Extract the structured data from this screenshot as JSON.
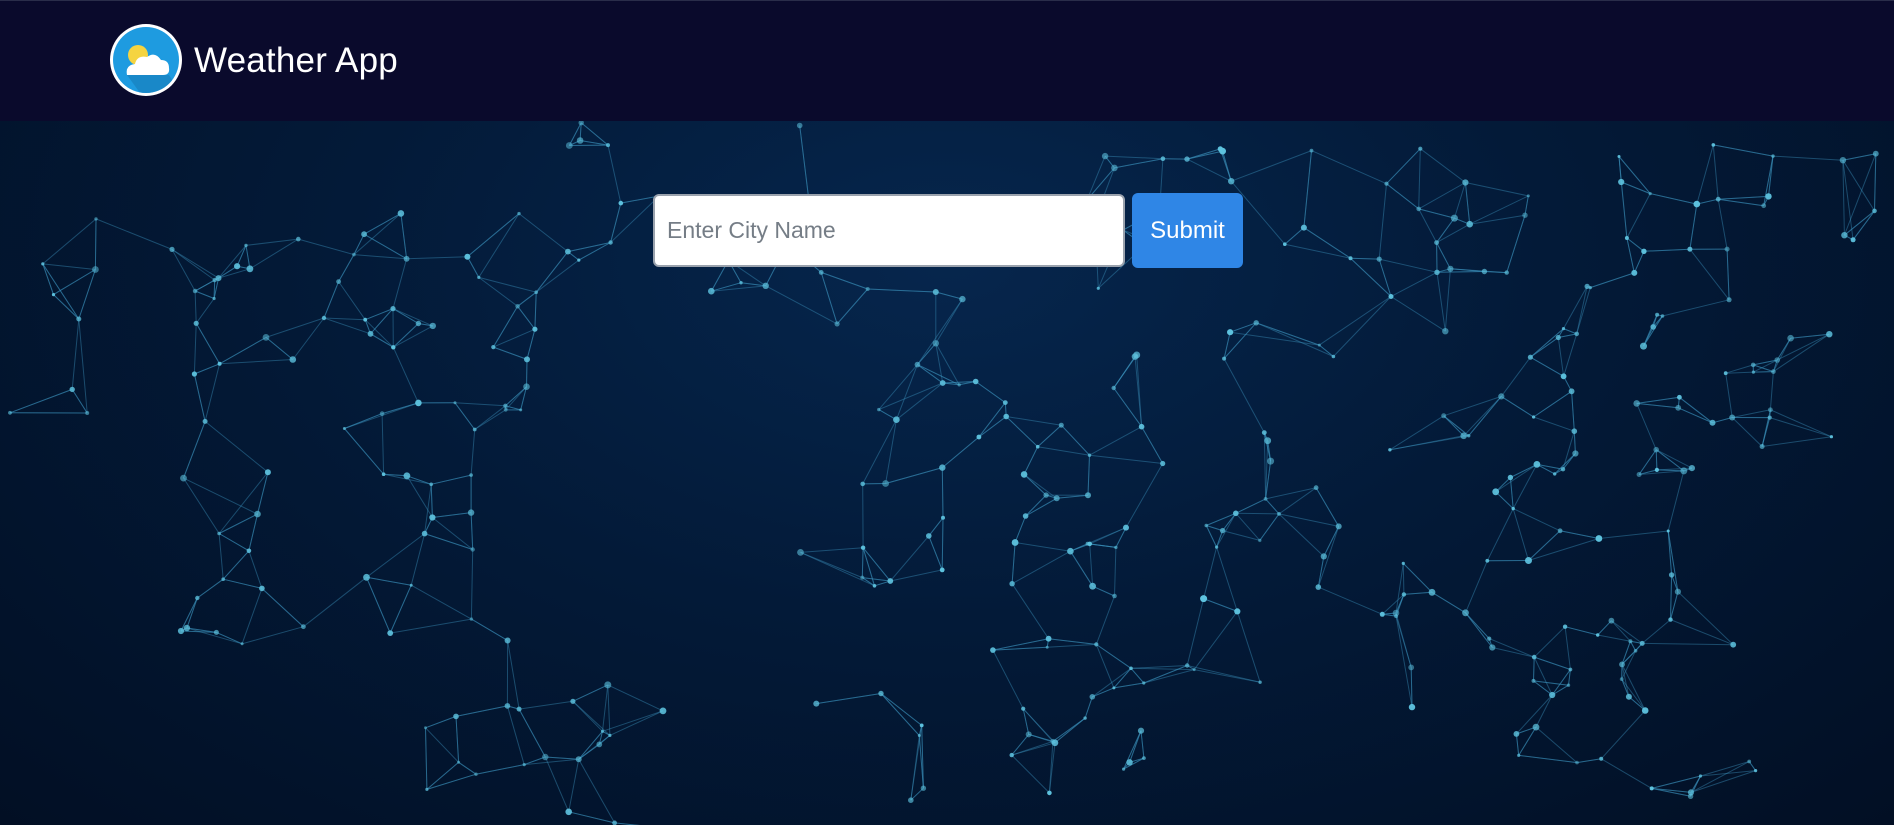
{
  "navbar": {
    "title": "Weather App",
    "logo_icon": "weather-cloud-sun-icon"
  },
  "search": {
    "placeholder": "Enter City Name",
    "value": "",
    "submit_label": "Submit"
  },
  "background": {
    "description_icon": "world-network-map-icon"
  },
  "colors": {
    "navbar_bg": "#0a0a2c",
    "hero_bg": "#031a38",
    "accent": "#2f86e6",
    "logo_bg": "#1e9be0",
    "node": "#4fb6d6"
  }
}
